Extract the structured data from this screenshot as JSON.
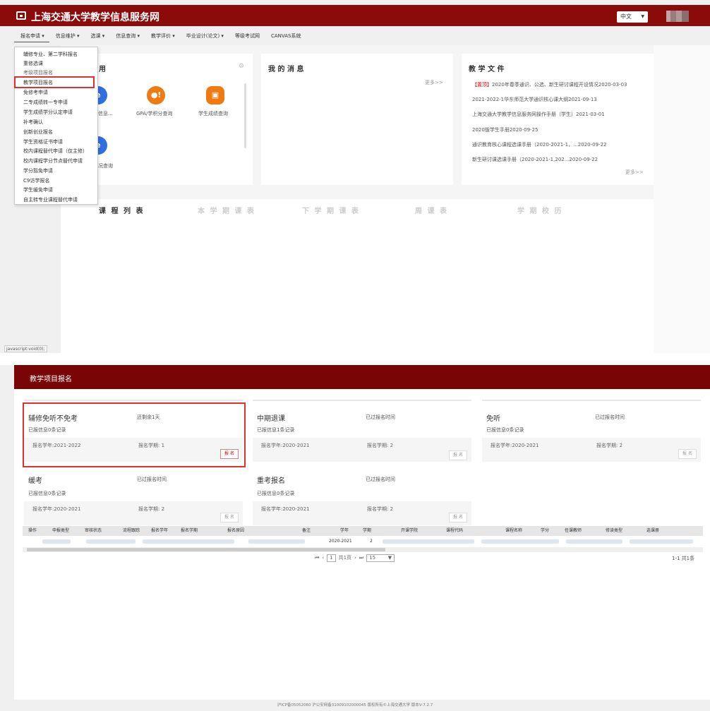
{
  "header": {
    "site_title": "上海交通大学教学信息服务网",
    "language": "中文",
    "language_caret": "▼"
  },
  "nav": [
    {
      "label": "报名申请 ▾"
    },
    {
      "label": "信息维护 ▾"
    },
    {
      "label": "选课 ▾"
    },
    {
      "label": "信息查询 ▾"
    },
    {
      "label": "教学评价 ▾"
    },
    {
      "label": "毕业设计(论文) ▾"
    },
    {
      "label": "等级考试网"
    },
    {
      "label": "CANVAS系统"
    }
  ],
  "dropdown": [
    "辅修专业、第二学科报名",
    "重修选课",
    "考级项目报名",
    "教学项目报名",
    "免修考申请",
    "二专成绩转一专申请",
    "学生成绩学分认定申请",
    "补考确认",
    "创新创业报名",
    "学生资格证书申请",
    "校内课程替代申请（仅主修）",
    "校内课程学分节点替代申请",
    "学分豁免申请",
    "C9访学报名",
    "学生缓免申请",
    "自主转专业课程替代申请"
  ],
  "apps_card": {
    "title": "用",
    "gear": "⚙",
    "items": [
      {
        "icon": "e",
        "label": "人信息..."
      },
      {
        "icon": "●!",
        "label": "GPA/学积分查询"
      },
      {
        "icon": "▣",
        "label": "学生成绩查询"
      },
      {
        "icon": "e",
        "label": "情况查询"
      }
    ]
  },
  "messages_card": {
    "title": "我 的 消 息",
    "more": "更多>>"
  },
  "docs_card": {
    "title": "教 学 文 件",
    "hot_tag": "【置顶】",
    "items": [
      "2020年春季通识、公选、新生研讨课程开设情况2020-03-03",
      "2021-2022-1华东师范大学通识核心课大纲2021-09-13",
      "上海交通大学教学信息服务网操作手册（学生）2021-03-01",
      "2020版学生手册2020-09-25",
      "通识教育核心课程选课手册（2020-2021-1，...2020-09-22",
      "新生研讨课选课手册（2020-2021-1,202...2020-09-22"
    ],
    "more": "更多>>"
  },
  "course_tabs": [
    "课 程 列 表",
    "本 学 期 课 表",
    "下 学 期 课 表",
    "周 课 表",
    "学 期 校 历"
  ],
  "status_bar": "javascript:void(0);",
  "project_page": {
    "title": "教学项目报名",
    "cards": [
      {
        "name": "辅修免听不免考",
        "status": "还剩余1天",
        "count": "已报信息0条记录",
        "year": "报名学年:2021-2022",
        "term": "报名学期: 1",
        "button": "报 名",
        "enabled": true
      },
      {
        "name": "中期退课",
        "status": "已过报名时间",
        "count": "已报信息1条记录",
        "year": "报名学年:2020-2021",
        "term": "报名学期: 2",
        "button": "报 名",
        "enabled": false
      },
      {
        "name": "免听",
        "status": "已过报名时间",
        "count": "已报信息0条记录",
        "year": "报名学年:2020-2021",
        "term": "报名学期: 2",
        "button": "报 名",
        "enabled": false
      },
      {
        "name": "缓考",
        "status": "已过报名时间",
        "count": "已报信息0条记录",
        "year": "报名学年:2020-2021",
        "term": "报名学期: 2",
        "button": "报 名",
        "enabled": false
      },
      {
        "name": "重考报名",
        "status": "已过报名时间",
        "count": "已报信息0条记录",
        "year": "报名学年:2020-2021",
        "term": "报名学期: 2",
        "button": "报 名",
        "enabled": false
      }
    ]
  },
  "grid": {
    "columns": [
      "操作",
      "申报类型",
      "审核状态",
      "流程跟踪",
      "报名学年",
      "报名学期",
      "报名原因",
      "备注",
      "学年",
      "学期",
      "开课学院",
      "课程代码",
      "课程名称",
      "学分",
      "任课教师",
      "修读类型",
      "选课册"
    ],
    "row": {
      "year": "2020-2021",
      "term": "2"
    },
    "pager": {
      "first": "⏮",
      "prev": "‹",
      "page": "1",
      "of": "共1页",
      "next": "›",
      "last": "⏭",
      "size": "15"
    },
    "info": "1-1 共1条"
  },
  "footer": "沪ICP备05052060 沪公安网备31009102000045 版权所有©上海交通大学 版本V-7.2.7"
}
